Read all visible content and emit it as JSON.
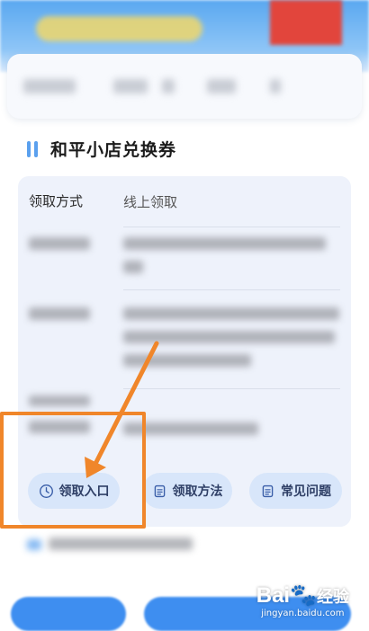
{
  "section": {
    "title": "和平小店兑换券"
  },
  "info": {
    "method_label": "领取方式",
    "method_value": "线上领取"
  },
  "actions": [
    {
      "label": "领取入口",
      "icon": "clock-icon"
    },
    {
      "label": "领取方法",
      "icon": "document-icon"
    },
    {
      "label": "常见问题",
      "icon": "document-icon"
    }
  ],
  "annotation": {
    "color": "#f0862a"
  },
  "watermark": {
    "brand": "Bai",
    "brand_suffix": "经验",
    "url": "jingyan.baidu.com"
  }
}
